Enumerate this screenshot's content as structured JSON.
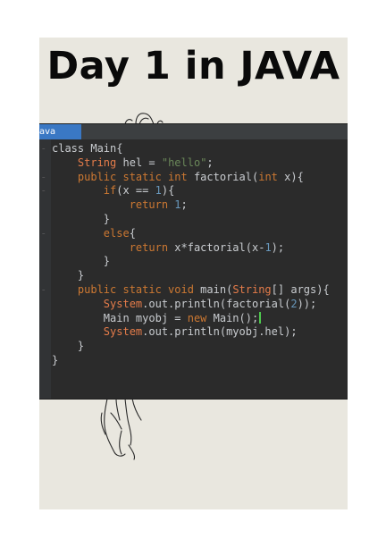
{
  "title": "Day 1 in JAVA",
  "editor": {
    "tab_label": "ava",
    "lines": [
      {
        "indent": 0,
        "tokens": [
          {
            "t": "class Main{",
            "c": "cls"
          }
        ]
      },
      {
        "indent": 1,
        "tokens": [
          {
            "t": "String",
            "c": "op"
          },
          {
            "t": " hel = ",
            "c": "cls"
          },
          {
            "t": "\"hello\"",
            "c": "str"
          },
          {
            "t": ";",
            "c": "cls"
          }
        ]
      },
      {
        "indent": 1,
        "tokens": [
          {
            "t": "public static int",
            "c": "kw"
          },
          {
            "t": " factorial(",
            "c": "cls"
          },
          {
            "t": "int",
            "c": "kw"
          },
          {
            "t": " x){",
            "c": "cls"
          }
        ]
      },
      {
        "indent": 2,
        "tokens": [
          {
            "t": "if",
            "c": "kw"
          },
          {
            "t": "(x == ",
            "c": "cls"
          },
          {
            "t": "1",
            "c": "num"
          },
          {
            "t": "){",
            "c": "cls"
          }
        ]
      },
      {
        "indent": 3,
        "tokens": [
          {
            "t": "return",
            "c": "kw"
          },
          {
            "t": " ",
            "c": "cls"
          },
          {
            "t": "1",
            "c": "num"
          },
          {
            "t": ";",
            "c": "cls"
          }
        ]
      },
      {
        "indent": 2,
        "tokens": [
          {
            "t": "}",
            "c": "cls"
          }
        ]
      },
      {
        "indent": 2,
        "tokens": [
          {
            "t": "else",
            "c": "kw"
          },
          {
            "t": "{",
            "c": "cls"
          }
        ]
      },
      {
        "indent": 3,
        "tokens": [
          {
            "t": "return",
            "c": "kw"
          },
          {
            "t": " x*factorial(x-",
            "c": "cls"
          },
          {
            "t": "1",
            "c": "num"
          },
          {
            "t": ");",
            "c": "cls"
          }
        ]
      },
      {
        "indent": 2,
        "tokens": [
          {
            "t": "}",
            "c": "cls"
          }
        ]
      },
      {
        "indent": 1,
        "tokens": [
          {
            "t": "}",
            "c": "cls"
          }
        ]
      },
      {
        "indent": 1,
        "tokens": [
          {
            "t": "public static void",
            "c": "kw"
          },
          {
            "t": " main(",
            "c": "cls"
          },
          {
            "t": "String",
            "c": "op"
          },
          {
            "t": "[] args){",
            "c": "cls"
          }
        ]
      },
      {
        "indent": 2,
        "tokens": [
          {
            "t": "System",
            "c": "op"
          },
          {
            "t": ".out.println(factorial(",
            "c": "cls"
          },
          {
            "t": "2",
            "c": "num"
          },
          {
            "t": "));",
            "c": "cls"
          }
        ]
      },
      {
        "indent": 2,
        "tokens": [
          {
            "t": "Main myobj = ",
            "c": "cls"
          },
          {
            "t": "new",
            "c": "kw"
          },
          {
            "t": " Main();",
            "c": "cls"
          }
        ],
        "cursor": true
      },
      {
        "indent": 2,
        "tokens": [
          {
            "t": "System",
            "c": "op"
          },
          {
            "t": ".out.println(myobj.hel);",
            "c": "cls"
          }
        ]
      },
      {
        "indent": 1,
        "tokens": [
          {
            "t": "}",
            "c": "cls"
          }
        ]
      },
      {
        "indent": 0,
        "tokens": [
          {
            "t": "}",
            "c": "cls"
          }
        ]
      }
    ]
  },
  "colors": {
    "poster_bg": "#e9e7df",
    "editor_bg": "#2b2b2b",
    "tab_active": "#3a78c4",
    "keyword": "#cc7832",
    "string": "#6a8759",
    "number": "#6897bb",
    "class_ref": "#e57c4a"
  },
  "icons": [
    "fold-marker-icon",
    "hand-sketch-illustration"
  ]
}
